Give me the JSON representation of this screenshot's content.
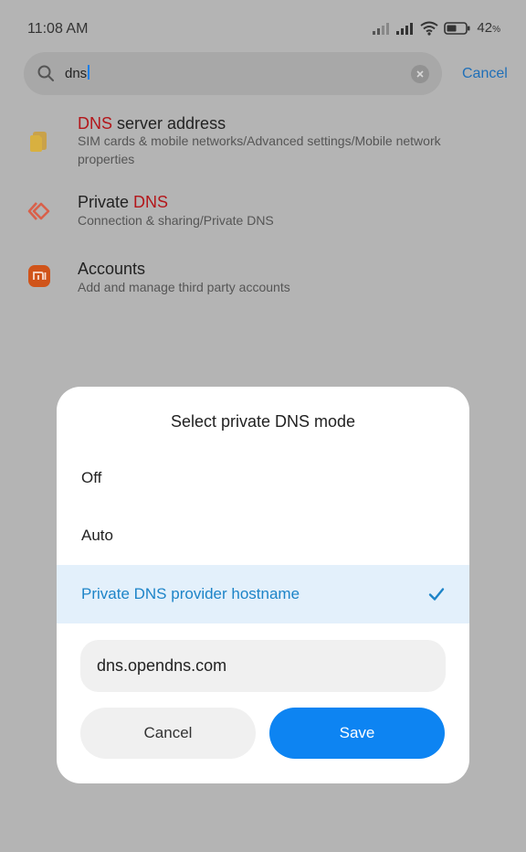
{
  "status_bar": {
    "time": "11:08 AM",
    "battery_percent": "42",
    "battery_unit": "%",
    "icons": [
      "signal-icon",
      "signal-icon",
      "wifi-icon",
      "battery-icon"
    ]
  },
  "search": {
    "query": "dns",
    "cancel_label": "Cancel"
  },
  "results": [
    {
      "title_highlight": "DNS",
      "title_rest": " server address",
      "subtitle_line1": "SIM cards & mobile networks/Advanced settings/Mobile network",
      "subtitle_line2": "properties",
      "icon": "sim-card-icon"
    },
    {
      "title_prefix": "Private ",
      "title_highlight": "DNS",
      "subtitle": "Connection & sharing/Private DNS",
      "icon": "connection-sharing-icon"
    },
    {
      "title": "Accounts",
      "subtitle": "Add and manage third party accounts",
      "icon": "mi-account-icon"
    }
  ],
  "dialog": {
    "title": "Select private DNS mode",
    "options": [
      {
        "label": "Off",
        "selected": false
      },
      {
        "label": "Auto",
        "selected": false
      },
      {
        "label": "Private DNS provider hostname",
        "selected": true
      }
    ],
    "hostname_value": "dns.opendns.com",
    "cancel_label": "Cancel",
    "save_label": "Save"
  },
  "colors": {
    "accent": "#0d84f2",
    "highlight_text": "#b3161a",
    "selected_row": "#e3f0fb",
    "selected_text": "#1d84c8"
  }
}
